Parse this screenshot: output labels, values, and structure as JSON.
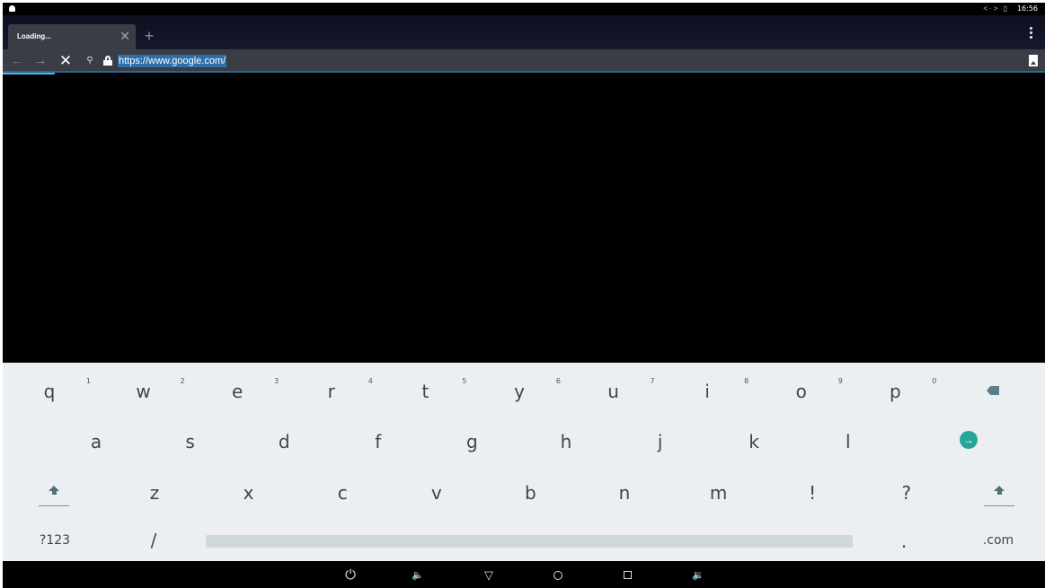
{
  "status_bar": {
    "time": "16:56",
    "indicators": "<·> ▯"
  },
  "tabs": [
    {
      "title": "Loading...",
      "close_label": "✕"
    }
  ],
  "new_tab_label": "+",
  "toolbar": {
    "back_icon": "←",
    "forward_icon": "→",
    "stop_icon": "✕",
    "search_icon": "⚲",
    "url": "https://www.google.com/"
  },
  "loading_progress_percent": 5,
  "keyboard": {
    "row1": [
      {
        "label": "q",
        "hint": "1"
      },
      {
        "label": "w",
        "hint": "2"
      },
      {
        "label": "e",
        "hint": "3"
      },
      {
        "label": "r",
        "hint": "4"
      },
      {
        "label": "t",
        "hint": "5"
      },
      {
        "label": "y",
        "hint": "6"
      },
      {
        "label": "u",
        "hint": "7"
      },
      {
        "label": "i",
        "hint": "8"
      },
      {
        "label": "o",
        "hint": "9"
      },
      {
        "label": "p",
        "hint": "0"
      }
    ],
    "row2": [
      "a",
      "s",
      "d",
      "f",
      "g",
      "h",
      "j",
      "k",
      "l"
    ],
    "row3": [
      "z",
      "x",
      "c",
      "v",
      "b",
      "n",
      "m",
      "!",
      "?"
    ],
    "go_icon": "→",
    "symbols_label": "?123",
    "slash_label": "/",
    "period_label": ".",
    "dotcom_label": ".com"
  },
  "nav_bar": {
    "power_icon": "⏻",
    "vol_down_icon": "🔈",
    "back_icon": "▽",
    "vol_up_icon": "🔉"
  }
}
